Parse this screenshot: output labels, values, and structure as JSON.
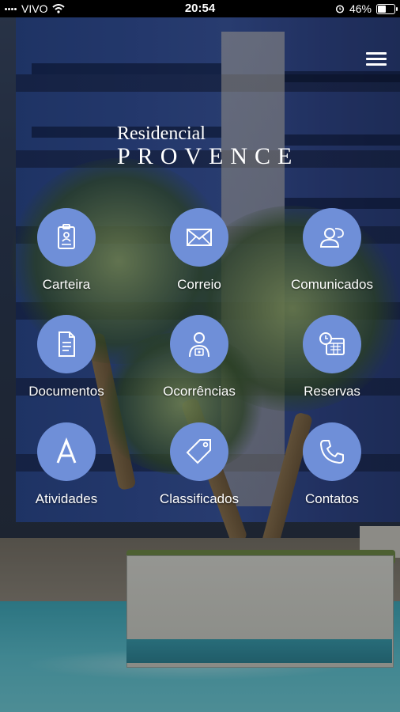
{
  "status_bar": {
    "carrier": "VIVO",
    "time": "20:54",
    "battery_percent": "46%",
    "battery_level": 0.46,
    "icons": [
      "signal-icon",
      "wifi-icon",
      "alarm-icon",
      "battery-icon"
    ]
  },
  "header": {
    "menu_icon": "hamburger-menu-icon",
    "logo_line1": "Residencial",
    "logo_line2": "PROVENCE"
  },
  "menu_items": [
    {
      "label": "Carteira",
      "icon": "id-badge-icon"
    },
    {
      "label": "Correio",
      "icon": "envelope-icon"
    },
    {
      "label": "Comunicados",
      "icon": "users-chat-icon"
    },
    {
      "label": "Documentos",
      "icon": "document-icon"
    },
    {
      "label": "Ocorrências",
      "icon": "doctor-report-icon"
    },
    {
      "label": "Reservas",
      "icon": "calendar-clock-icon"
    },
    {
      "label": "Atividades",
      "icon": "letter-a-icon"
    },
    {
      "label": "Classificados",
      "icon": "price-tag-icon"
    },
    {
      "label": "Contatos",
      "icon": "phone-icon"
    }
  ],
  "colors": {
    "icon_circle": "#6f8fd8",
    "text": "#ffffff",
    "status_bar_bg": "#000000"
  }
}
